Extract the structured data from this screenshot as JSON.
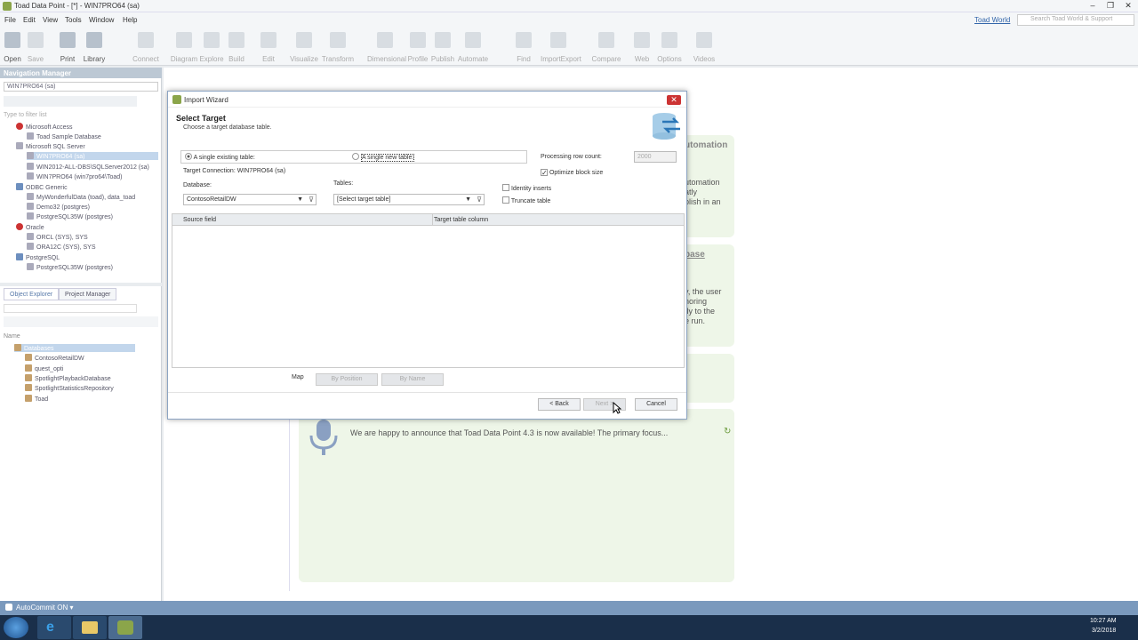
{
  "window": {
    "title": "Toad Data Point - [*] - WIN7PRO64 (sa)",
    "min": "–",
    "max": "❐",
    "close": "✕"
  },
  "menu": [
    "File",
    "Edit",
    "View",
    "Tools",
    "Window",
    "Help"
  ],
  "menu_right": {
    "link": "Toad World",
    "search_placeholder": "Search Toad World & Support"
  },
  "toolbar": [
    {
      "label": "Open"
    },
    {
      "label": "Save"
    },
    {
      "label": "Print"
    },
    {
      "label": "Library"
    },
    {
      "label": "Connect"
    },
    {
      "label": "Diagram"
    },
    {
      "label": "Explore"
    },
    {
      "label": "Build"
    },
    {
      "label": "Edit"
    },
    {
      "label": "Visualize"
    },
    {
      "label": "Transform"
    },
    {
      "label": "Dimensional"
    },
    {
      "label": "Profile"
    },
    {
      "label": "Publish"
    },
    {
      "label": "Automate"
    },
    {
      "label": "Find"
    },
    {
      "label": "ImportExport"
    },
    {
      "label": "Compare"
    },
    {
      "label": "Web"
    },
    {
      "label": "Options"
    },
    {
      "label": "Videos"
    }
  ],
  "nav_manager": {
    "header": "Navigation Manager",
    "connection": "WIN7PRO64 (sa)",
    "filter_placeholder": "Type to filter list",
    "tree": [
      {
        "label": "Microsoft Access",
        "level": 0
      },
      {
        "label": "Toad Sample Database",
        "level": 1
      },
      {
        "label": "Microsoft SQL Server",
        "level": 0
      },
      {
        "label": "WIN7PRO64 (sa)",
        "level": 1,
        "selected": true
      },
      {
        "label": "WIN2012-ALL-DBS\\SQLServer2012 (sa)",
        "level": 1
      },
      {
        "label": "WIN7PRO64 (win7pro64\\Toad)",
        "level": 1
      },
      {
        "label": "ODBC Generic",
        "level": 0
      },
      {
        "label": "MyWonderfulData (toad), data_toad",
        "level": 1
      },
      {
        "label": "Demo32 (postgres)",
        "level": 1
      },
      {
        "label": "PostgreSQL35W (postgres)",
        "level": 1
      },
      {
        "label": "Oracle",
        "level": 0
      },
      {
        "label": "ORCL (SYS), SYS",
        "level": 1
      },
      {
        "label": "ORA12C (SYS), SYS",
        "level": 1
      },
      {
        "label": "PostgreSQL",
        "level": 0
      },
      {
        "label": "PostgreSQL35W (postgres)",
        "level": 1
      }
    ]
  },
  "object_explorer": {
    "tabs": [
      "Object Explorer",
      "Project Manager"
    ],
    "name_header": "Name",
    "tree": [
      {
        "label": "Databases",
        "selected": true
      },
      {
        "label": "ContosoRetailDW"
      },
      {
        "label": "quest_opti"
      },
      {
        "label": "SpotlightPlaybackDatabase"
      },
      {
        "label": "SpotlightStatisticsRepository"
      },
      {
        "label": "Toad"
      }
    ]
  },
  "background_cards": {
    "card1_head": "utomation",
    "card1_lines": [
      "utomation",
      "atly",
      "plish in an"
    ],
    "card2_head": "base",
    "card2_lines": [
      "y, the user",
      "noring",
      "tly to the",
      "e run."
    ],
    "news_text": "We are happy to announce that Toad Data Point 4.3 is now available!   The primary focus..."
  },
  "dialog": {
    "title": "Import Wizard",
    "heading": "Select Target",
    "subheading": "Choose a target database table.",
    "radio_existing": "A single existing table:",
    "radio_new": "A single new table:",
    "target_connection": "Target Connection: WIN7PRO64 (sa)",
    "processing_label": "Processing row count:",
    "processing_value": "2000",
    "optimize_label": "Optimize block size",
    "database_label": "Database:",
    "database_value": "ContosoRetailDW",
    "tables_label": "Tables:",
    "tables_value": "[Select target table]",
    "identity_inserts": "Identity inserts",
    "truncate_table": "Truncate table",
    "col_source": "Source field",
    "col_target": "Target table column",
    "map_label": "Map",
    "by_position": "By Position",
    "by_name": "By Name",
    "back": "< Back",
    "next": "Next >",
    "cancel": "Cancel"
  },
  "statusbar": {
    "autocommit": "AutoCommit ON ▾"
  },
  "taskbar": {
    "time": "10:27 AM",
    "date": "3/2/2018"
  }
}
